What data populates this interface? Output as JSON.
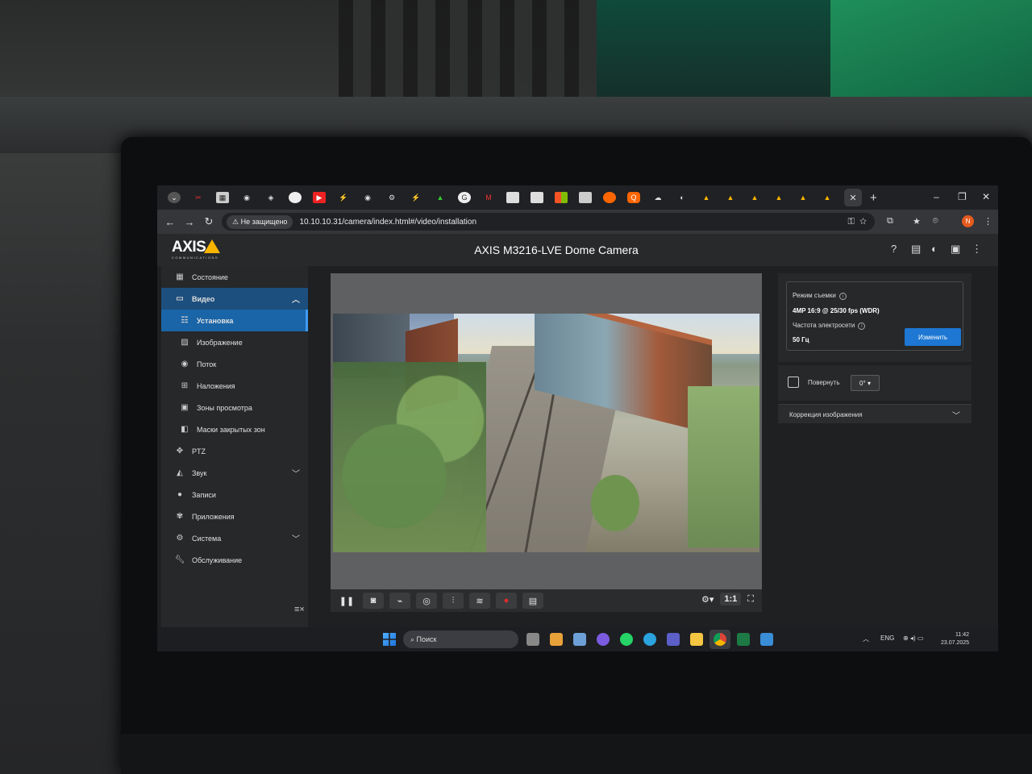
{
  "browser": {
    "secure_chip": "Не защищено",
    "url": "10.10.10.31/camera/index.html#/video/installation",
    "tab_close": "✕",
    "new_tab": "+"
  },
  "app": {
    "logo_text": "AXIS",
    "logo_subtext": "COMMUNICATIONS",
    "title": "AXIS M3216-LVE Dome Camera",
    "accent_color": "#1a65a8",
    "button_color": "#1d77d3"
  },
  "sidebar": {
    "items": [
      {
        "label": "Состояние",
        "icon": "dashboard-icon"
      },
      {
        "label": "Видео",
        "icon": "video-icon"
      },
      {
        "label": "Установка",
        "icon": "installation-icon"
      },
      {
        "label": "Изображение",
        "icon": "image-icon"
      },
      {
        "label": "Поток",
        "icon": "stream-icon"
      },
      {
        "label": "Наложения",
        "icon": "overlay-icon"
      },
      {
        "label": "Зоны просмотра",
        "icon": "view-area-icon"
      },
      {
        "label": "Маски закрытых зон",
        "icon": "privacy-mask-icon"
      },
      {
        "label": "PTZ",
        "icon": "ptz-icon"
      },
      {
        "label": "Звук",
        "icon": "audio-icon"
      },
      {
        "label": "Записи",
        "icon": "recordings-icon"
      },
      {
        "label": "Приложения",
        "icon": "apps-icon"
      },
      {
        "label": "Система",
        "icon": "system-icon"
      },
      {
        "label": "Обслуживание",
        "icon": "maintenance-icon"
      }
    ]
  },
  "viewer": {
    "ratio_label": "1:1"
  },
  "panel": {
    "capture_mode_label": "Режим съемки",
    "capture_mode_value": "4MP 16:9 @ 25/30 fps (WDR)",
    "power_freq_label": "Частота электросети",
    "power_freq_value": "50 Гц",
    "change_button": "Изменить",
    "rotate_label": "Повернуть",
    "rotate_value": "0°",
    "correction_label": "Коррекция изображения"
  },
  "taskbar": {
    "search_placeholder": "Поиск",
    "lang": "ENG",
    "time": "11:42",
    "date": "23.07.2025"
  }
}
